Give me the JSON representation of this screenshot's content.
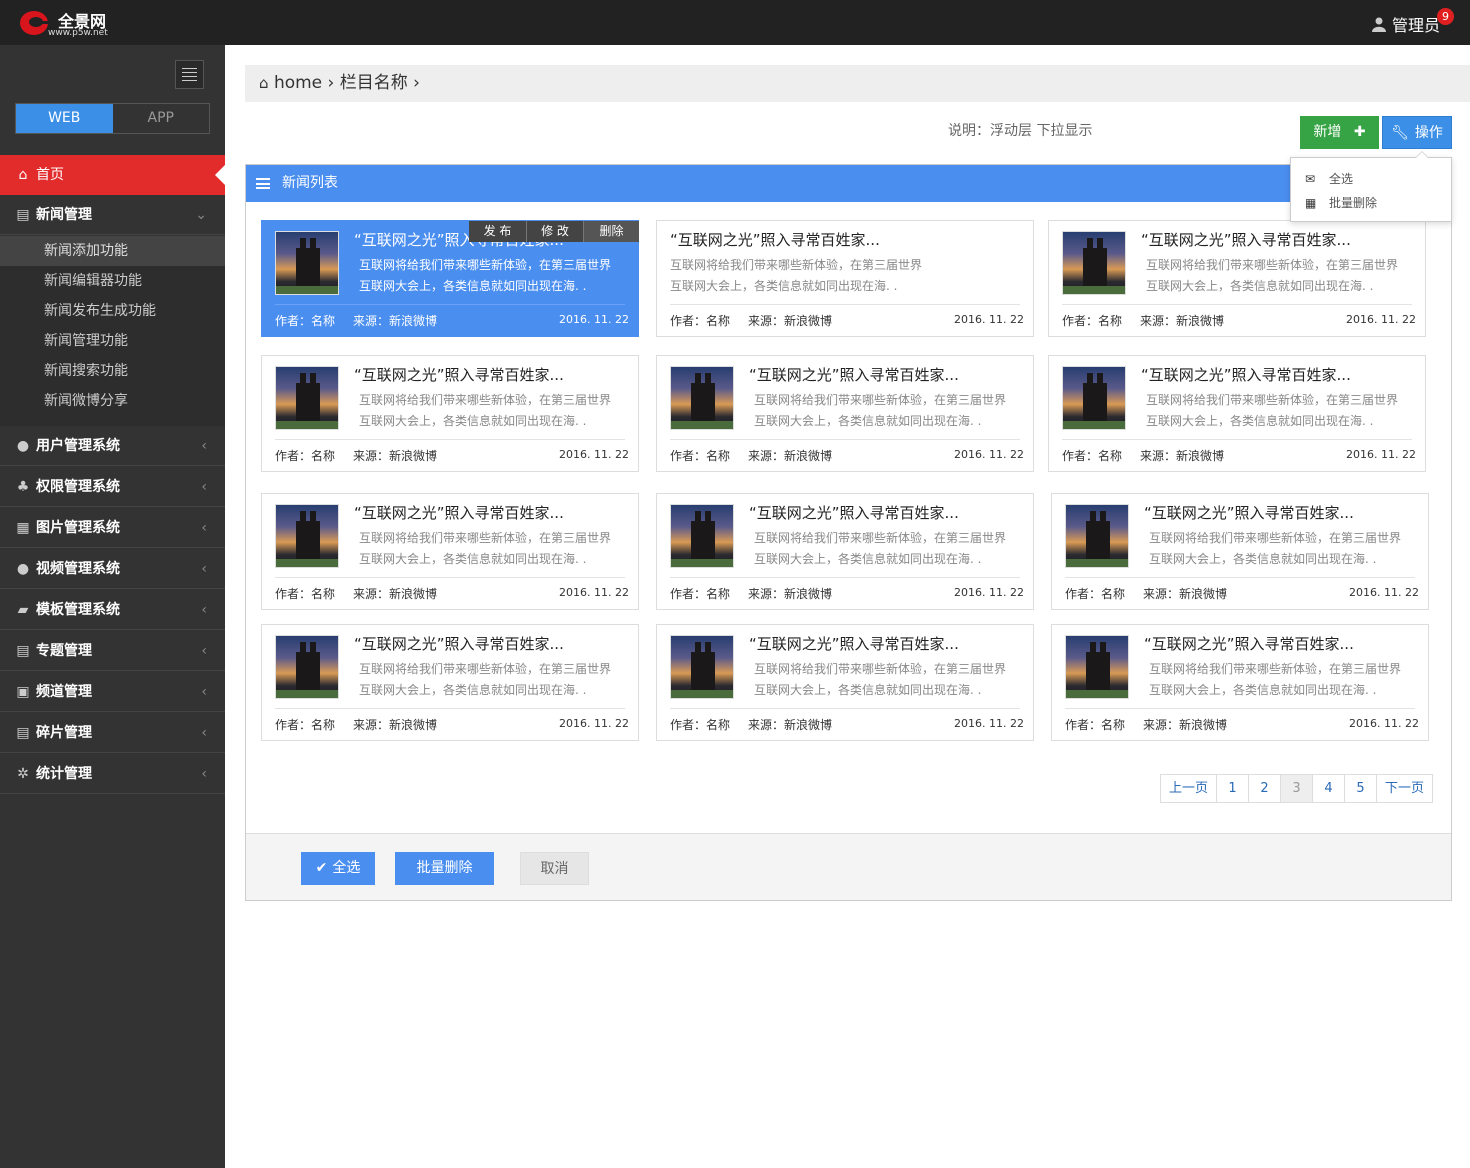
{
  "header": {
    "logo_name": "全景网",
    "logo_url": "www.p5w.net",
    "admin_label": "管理员",
    "notification_count": "9"
  },
  "sidebar": {
    "segments": [
      "WEB",
      "APP"
    ],
    "home": "首页",
    "news_group": "新闻管理",
    "news_sub": [
      "新闻添加功能",
      "新闻编辑器功能",
      "新闻发布生成功能",
      "新闻管理功能",
      "新闻搜索功能",
      "新闻微博分享"
    ],
    "items": [
      "用户管理系统",
      "权限管理系统",
      "图片管理系统",
      "视频管理系统",
      "模板管理系统",
      "专题管理",
      "频道管理",
      "碎片管理",
      "统计管理"
    ]
  },
  "breadcrumb": {
    "home": "home",
    "sep": "›",
    "category": "栏目名称"
  },
  "toolbar": {
    "note": "说明：浮动层 下拉显示",
    "new_label": "新增",
    "op_label": "操作"
  },
  "dropdown": {
    "items": [
      "全选",
      "批量删除"
    ]
  },
  "panel": {
    "title": "新闻列表"
  },
  "card_actions": [
    "发 布",
    "修 改",
    "删除"
  ],
  "cards": [
    {
      "title": "“互联网之光”照入寻常百姓家...",
      "desc1": "互联网将给我们带来哪些新体验，在第三届世界",
      "desc2": "互联网大会上，各类信息就如同出现在海. .",
      "author": "作者：名称",
      "source": "来源：新浪微博",
      "date": "2016. 11. 22"
    },
    {
      "title": "“互联网之光”照入寻常百姓家...",
      "desc1": "互联网将给我们带来哪些新体验，在第三届世界",
      "desc2": "互联网大会上，各类信息就如同出现在海. .",
      "author": "作者：名称",
      "source": "来源：新浪微博",
      "date": "2016. 11. 22"
    },
    {
      "title": "“互联网之光”照入寻常百姓家...",
      "desc1": "互联网将给我们带来哪些新体验，在第三届世界",
      "desc2": "互联网大会上，各类信息就如同出现在海. .",
      "author": "作者：名称",
      "source": "来源：新浪微博",
      "date": "2016. 11. 22"
    },
    {
      "title": "“互联网之光”照入寻常百姓家...",
      "desc1": "互联网将给我们带来哪些新体验，在第三届世界",
      "desc2": "互联网大会上，各类信息就如同出现在海. .",
      "author": "作者：名称",
      "source": "来源：新浪微博",
      "date": "2016. 11. 22"
    },
    {
      "title": "“互联网之光”照入寻常百姓家...",
      "desc1": "互联网将给我们带来哪些新体验，在第三届世界",
      "desc2": "互联网大会上，各类信息就如同出现在海. .",
      "author": "作者：名称",
      "source": "来源：新浪微博",
      "date": "2016. 11. 22"
    },
    {
      "title": "“互联网之光”照入寻常百姓家...",
      "desc1": "互联网将给我们带来哪些新体验，在第三届世界",
      "desc2": "互联网大会上，各类信息就如同出现在海. .",
      "author": "作者：名称",
      "source": "来源：新浪微博",
      "date": "2016. 11. 22"
    },
    {
      "title": "“互联网之光”照入寻常百姓家...",
      "desc1": "互联网将给我们带来哪些新体验，在第三届世界",
      "desc2": "互联网大会上，各类信息就如同出现在海. .",
      "author": "作者：名称",
      "source": "来源：新浪微博",
      "date": "2016. 11. 22"
    },
    {
      "title": "“互联网之光”照入寻常百姓家...",
      "desc1": "互联网将给我们带来哪些新体验，在第三届世界",
      "desc2": "互联网大会上，各类信息就如同出现在海. .",
      "author": "作者：名称",
      "source": "来源：新浪微博",
      "date": "2016. 11. 22"
    },
    {
      "title": "“互联网之光”照入寻常百姓家...",
      "desc1": "互联网将给我们带来哪些新体验，在第三届世界",
      "desc2": "互联网大会上，各类信息就如同出现在海. .",
      "author": "作者：名称",
      "source": "来源：新浪微博",
      "date": "2016. 11. 22"
    },
    {
      "title": "“互联网之光”照入寻常百姓家...",
      "desc1": "互联网将给我们带来哪些新体验，在第三届世界",
      "desc2": "互联网大会上，各类信息就如同出现在海. .",
      "author": "作者：名称",
      "source": "来源：新浪微博",
      "date": "2016. 11. 22"
    },
    {
      "title": "“互联网之光”照入寻常百姓家...",
      "desc1": "互联网将给我们带来哪些新体验，在第三届世界",
      "desc2": "互联网大会上，各类信息就如同出现在海. .",
      "author": "作者：名称",
      "source": "来源：新浪微博",
      "date": "2016. 11. 22"
    },
    {
      "title": "“互联网之光”照入寻常百姓家...",
      "desc1": "互联网将给我们带来哪些新体验，在第三届世界",
      "desc2": "互联网大会上，各类信息就如同出现在海. .",
      "author": "作者：名称",
      "source": "来源：新浪微博",
      "date": "2016. 11. 22"
    }
  ],
  "pagination": {
    "prev": "上一页",
    "pages": [
      "1",
      "2",
      "3",
      "4",
      "5"
    ],
    "current": "3",
    "next": "下一页"
  },
  "footer": {
    "select_all": "全选",
    "batch_delete": "批量删除",
    "cancel": "取消"
  },
  "colors": {
    "accent": "#4a8ef0",
    "danger": "#e22b2b",
    "success": "#36a344",
    "sidebar": "#333333",
    "topbar": "#222222"
  }
}
